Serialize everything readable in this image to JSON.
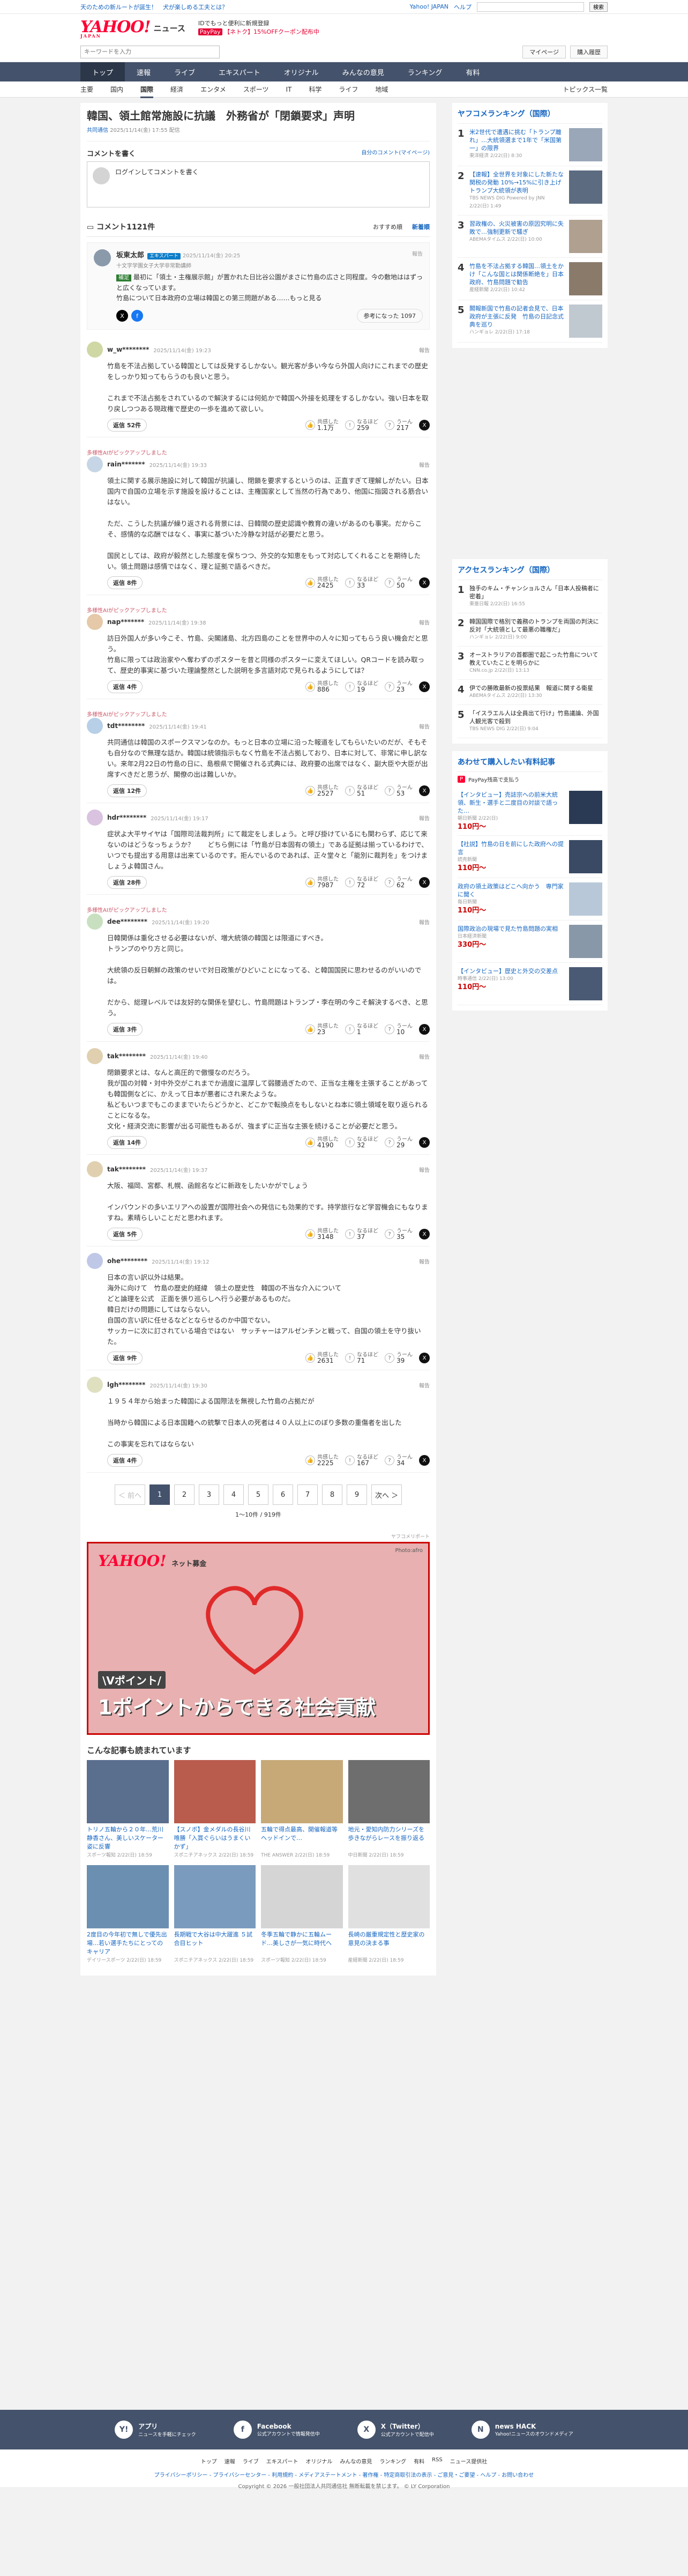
{
  "topbar": {
    "promo": "天のための新ルートが誕生！　犬が楽しめる工夫とは？",
    "links": [
      "Yahoo! JAPAN",
      "ヘルプ"
    ],
    "search_placeholder": "",
    "search_button": "検索"
  },
  "header": {
    "logo": "YAHOO!",
    "logo_sub": "JAPAN",
    "section": "ニュース",
    "promo1": "IDでもっと便利に新規登録",
    "promo2_badge": "PayPay",
    "promo2": "【ネトク】15%OFFクーポン配布中"
  },
  "search": {
    "placeholder": "キーワードを入力",
    "mypage": "マイページ",
    "settings": "購入履歴"
  },
  "gnav": [
    "トップ",
    "速報",
    "ライブ",
    "エキスパート",
    "オリジナル",
    "みんなの意見",
    "ランキング",
    "有料"
  ],
  "subnav": [
    "主要",
    "国内",
    "国際",
    "経済",
    "エンタメ",
    "スポーツ",
    "IT",
    "科学",
    "ライフ",
    "地域"
  ],
  "subnav_right": "トピックス一覧",
  "article": {
    "title": "韓国、領土館常施設に抗議　外務省が「閉鎖要求」声明",
    "source": "共同通信",
    "date": "2025/11/14(金) 17:55 配信"
  },
  "comment_write": {
    "title": "コメントを書く",
    "link": "自分のコメント(マイページ)",
    "placeholder": "ログインしてコメントを書く"
  },
  "comments_header": {
    "label": "コメント1121件",
    "sort1": "おすすめ順",
    "sort2": "新着順"
  },
  "expert": {
    "name": "坂東太郎",
    "badge": "エキスパート",
    "meta": "2025/11/14(金) 20:25",
    "role": "十文字学園女子大学非常勤講師",
    "tag": "補足",
    "body": "最初に「領土・主権展示館」が置かれた日比谷公園がまさに竹島の広さと同程度。今の敷地ははずっと広くなっています。\n竹島について日本政府の立場は韓国との第三問題がある……もっと見る",
    "helpful": "参考になった 1097",
    "report": "報告"
  },
  "comments": [
    {
      "user": "w_w********",
      "time": "2025/11/14(金) 19:23",
      "body": "竹島を不法占拠している韓国としては反発するしかない。観光客が多い今なら外国人向けにこれまでの歴史をしっかり知ってもらうのも良いと思う。\n\nこれまで不法占拠をされているので解決するには何処かで韓国へ外接を処理をするしかない。強い日本を取り戻しつつある現政権で歴史の一歩を進めて欲しい。",
      "replies": "返信 52件",
      "v1": "1.1万",
      "v2": "259",
      "v3": "217",
      "color": "#cfd8a4",
      "pin": ""
    },
    {
      "user": "rain*******",
      "time": "2025/11/14(金) 19:33",
      "body": "領土に関する展示施設に対して韓国が抗議し、閉鎖を要求するというのは、正直すぎて理解しがたい。日本国内で自国の立場を示す施設を設けることは、主権国家として当然の行為であり、他国に指図される筋合いはない。\n\nただ、こうした抗議が繰り返される背景には、日韓間の歴史認識や教育の違いがあるのも事実。だからこそ、感情的な応酬ではなく、事実に基づいた冷静な対話が必要だと思う。\n\n国民としては、政府が毅然とした態度を保ちつつ、外交的な知恵をもって対応してくれることを期待したい。領土問題は感情ではなく、理と証拠で語るべきだ。",
      "replies": "返信 8件",
      "v1": "2425",
      "v2": "33",
      "v3": "50",
      "color": "#c6d6e6",
      "pin": "多様性AIがピックアップしました"
    },
    {
      "user": "nap*******",
      "time": "2025/11/14(金) 19:38",
      "body": "訪日外国人が多い今こそ、竹島、尖閣諸島、北方四島のことを世界中の人々に知ってもらう良い機会だと思う。\n竹島に限っては政治家やへ奪わずのポスターを昔と同様のポスターに変えてほしい。QRコードを読み取って、歴史的事実に基づいた理論整然とした説明を多言語対応で見られるようにしては？",
      "replies": "返信 4件",
      "v1": "886",
      "v2": "19",
      "v3": "23",
      "color": "#e5c9a8",
      "pin": "多様性AIがピックアップしました"
    },
    {
      "user": "tdt********",
      "time": "2025/11/14(金) 19:41",
      "body": "共同通信は韓国のスポークスマンなのか。もっと日本の立場に沿った報道をしてもらいたいのだが、そもそも自分なので無理な話か。韓国は統領指示もなく竹島を不法占拠しており、日本に対して、非常に申し訳ない。来年2月22日の竹島の日に、島根県で開催される式典には、政府要の出席ではなく、副大臣や大臣が出席すべきだと思うが、閣僚の出は難しいか。",
      "replies": "返信 12件",
      "v1": "2527",
      "v2": "51",
      "v3": "53",
      "color": "#b8cfe8",
      "pin": "多様性AIがピックアップしました"
    },
    {
      "user": "hdr********",
      "time": "2025/11/14(金) 19:17",
      "body": "症状よ大平サイヤは「国際司法裁判所」にて裁定をしましょう。と呼び掛けているにも関わらず、応じて来ないのはどうなっちょうか？　　どちら側には「竹島が日本固有の領土」である証拠は揃っているわけで、いつでも提出する用意は出来ているのです。拒んでいるのであれば、正々堂々と「能別に裁判を」をつけましょうよ韓国さん。",
      "replies": "返信 28件",
      "v1": "7987",
      "v2": "72",
      "v3": "62",
      "color": "#d9c3e0",
      "pin": ""
    },
    {
      "user": "dee********",
      "time": "2025/11/14(金) 19:20",
      "body": "日韓関係は重化させる必要はないが、増大統領の韓国とは限道にすべき。\nトランプのやり方と同じ。\n\n大統領の反日朝鮮の政策のせいで対日政策がひどいことになってる、と韓国国民に思わせるのがいいのでは。\n\nだから、総理レベルでは友好的な関係を望むし、竹島問題はトランプ・李在明の今こそ解決するべき、と思う。",
      "replies": "返信 3件",
      "v1": "23",
      "v2": "1",
      "v3": "10",
      "color": "#c8e0c0",
      "pin": "多様性AIがピックアップしました"
    },
    {
      "user": "tak********",
      "time": "2025/11/14(金) 19:40",
      "body": "閉鎖要求とは、なんと高圧的で傲慢なのだろう。\n我が国の対韓・対中外交がこれまでか過度に温厚して弱腰過ぎたので、正当な主権を主張することがあっても韓国側などに、かえって日本が悪者にされ来たような。\n私どもいつまでもこのままでいたらどうかと、どこかで転換点をもしないとね本に領土領域を取り返られることになるな。\n文化・経済交流に影響が出る可能性もあるが、強まずに正当な主張を続けることが必要だと思う。",
      "replies": "返信 14件",
      "v1": "4190",
      "v2": "32",
      "v3": "29",
      "color": "#e0d0b0",
      "pin": ""
    },
    {
      "user": "tak********",
      "time": "2025/11/14(金) 19:37",
      "body": "大阪、福岡、宮都、札幌、函館名などに新政をしたいかがでしょう\n\nインバウンドの多いエリアへの設置が国際社会への発信にも効果的です。持学旅行など学習機会にもなりますね。素晴らしいことだと思われます。",
      "replies": "返信 5件",
      "v1": "3148",
      "v2": "37",
      "v3": "35",
      "color": "#e0d0b0",
      "pin": ""
    },
    {
      "user": "ohe********",
      "time": "2025/11/14(金) 19:12",
      "body": "日本の言い訳以外は結果。\n海外に向けて　竹島の歴史的経緯　領土の歴史性　韓国の不当な介入について\nどと論理を公式　正面を張り巡らしへ行う必要があるものだ。\n韓日だけの問題にしてはならない。\n自国の言い訳に任せるなどとならせるのか中国でない。\nサッカーに次に訂されている場合ではない　サッチャーはアルゼンチンと戦って、自国の領土を守り抜いた。",
      "replies": "返信 9件",
      "v1": "2631",
      "v2": "71",
      "v3": "39",
      "color": "#c0c8e8",
      "pin": ""
    },
    {
      "user": "lgh********",
      "time": "2025/11/14(金) 19:30",
      "body": "１９５４年から始まった韓国による国際法を無視した竹島の占拠だが\n\n当時から韓国による日本国籍への銃撃で日本人の死者は４０人以上にのぼり多数の重傷者を出した\n\nこの事実を忘れてはならない",
      "replies": "返信 4件",
      "v1": "2225",
      "v2": "167",
      "v3": "34",
      "color": "#dfe0c0",
      "pin": ""
    }
  ],
  "labels": {
    "report": "報告",
    "helpful": "共感した",
    "think": "なるほど",
    "hmm": "うーん"
  },
  "pager": {
    "prev": "＜ 前へ",
    "pages": [
      "1",
      "2",
      "3",
      "4",
      "5",
      "6",
      "7",
      "8",
      "9"
    ],
    "next": "次へ ＞",
    "info": "1〜10件 / 919件"
  },
  "ad": {
    "label": "ヤフコメリポート",
    "logo": "YAHOO!",
    "logo_sub": "ネット募金",
    "credit": "Photo:afro",
    "line1": "\\Vポイント/",
    "line2": "1ポイントからできる社会貢献"
  },
  "related": {
    "title": "こんな記事も読まれています",
    "items": [
      {
        "title": "トリノ五輪から２０年…荒川静香さん、美しいスケーター姿に反響",
        "meta": "スポーツ報知",
        "date": "2/22(日) 18:59",
        "color": "#5a6e8e"
      },
      {
        "title": "【スノボ】金メダルの長谷川唯勝「入賞ぐらいはうまくいかず」",
        "meta": "スポニチアネックス",
        "date": "2/22(日) 18:59",
        "color": "#b95b4d"
      },
      {
        "title": "五輪で得点最高、開催報道等ヘッドインで…",
        "meta": "THE ANSWER",
        "date": "2/22(日) 18:59",
        "color": "#c7a978"
      },
      {
        "title": "地元・愛知内防力シリーズを歩きながらレースを振り返る",
        "meta": "中日新聞",
        "date": "2/22(日) 18:59",
        "color": "#6e6e6e"
      },
      {
        "title": "2度目の今年初で無しで優先出場…若い選手たちにとってのキャリア",
        "meta": "デイリースポーツ",
        "date": "2/22(日) 18:59",
        "color": "#6b8fb0"
      },
      {
        "title": "長期戦で大谷は中大躍進 ５試合目ヒット",
        "meta": "スポニチアネックス",
        "date": "2/22(日) 18:59",
        "color": "#7a9bbd"
      },
      {
        "title": "冬季五輪で静かに五輪ムード…美しさが一気に時代へ",
        "meta": "スポーツ報知",
        "date": "2/22(日) 18:59",
        "color": "#d5d5d5"
      },
      {
        "title": "長崎の厳重規定性と歴史家の意見の決まる事",
        "meta": "産経新聞",
        "date": "2/22(日) 18:59",
        "color": "#e0e0e0"
      }
    ]
  },
  "side": {
    "expert_ranking": {
      "title": "ヤフコメランキング（国際）",
      "items": [
        {
          "text": "米2世代で遭遇に挑む「トランプ離れ」…大統領選まで1年で「米国第一」の限界",
          "meta": "東洋経済 2/22(日) 8:30"
        },
        {
          "text": "【速報】全世界を対象にした新たな関税の発動 10%→15%に引き上げ　トランプ大統領が表明",
          "meta": "TBS NEWS DIG Powered by JNN 2/22(日) 1:49"
        },
        {
          "text": "習政権の、火災被害の原因究明に失敗で…強制更新で騒ぎ",
          "meta": "ABEMAタイムス 2/22(日) 10:00"
        },
        {
          "text": "竹島を不法占拠する韓国…領土をかけ「こんな国とは関係断絶を」日本政府、竹島問題で勧告",
          "meta": "産経新聞 2/22(日) 10:42"
        },
        {
          "text": "閣報新国で竹島の記者会見で、日本政府が主張に反発　竹島の日記念式典を巡り",
          "meta": "ハンギョレ 2/22(日) 17:18"
        }
      ]
    },
    "access_ranking": {
      "title": "アクセスランキング（国際）",
      "items": [
        {
          "text": "独手のキム・チャンショルさん「日本人投稿者に密着」",
          "meta": "東亜日報 2/22(日) 16:55"
        },
        {
          "text": "韓国国際で格別で義務のトランプを両国の判決に反対「大統領として最悪の職権だ」",
          "meta": "ハンギョレ 2/22(日) 9:00"
        },
        {
          "text": "オーストラリアの首都圏で起こった竹島について教えていたことを明らかに",
          "meta": "CNN.co.jp 2/22(日) 13:13"
        },
        {
          "text": "伊での勝敗最新の投票結果　報道に関する衛星",
          "meta": "ABEMAタイムス 2/22(日) 13:30"
        },
        {
          "text": "「イスラエル人は全員出て行け」竹島議論、外国人観光客で殺到",
          "meta": "TBS NEWS DIG 2/22(日) 9:04"
        }
      ]
    },
    "shop": {
      "title": "あわせて購入したい有料記事",
      "sub": "PayPay残高で支払う",
      "items": [
        {
          "text": "【インタビュー】売誌宗への前米大統領、新生・選手と二度目の対談で語った…",
          "meta": "朝日新聞 2/22(日)",
          "price": "110円〜",
          "color": "#2a3a55"
        },
        {
          "text": "【社説】竹島の日を前にした政府への提言",
          "meta": "読売新聞",
          "price": "110円〜",
          "color": "#3a4a65"
        },
        {
          "text": "政府の領土政策はどこへ向かう　専門家に聞く",
          "meta": "毎日新聞",
          "price": "110円〜",
          "color": "#b8c8d8"
        },
        {
          "text": "国際政治の現場で見た竹島問題の実相",
          "meta": "日本経済新聞",
          "price": "330円〜",
          "color": "#8898a8"
        },
        {
          "text": "【インタビュー】歴史と外交の交差点",
          "meta": "時事通信 2/22(日) 13:00",
          "price": "110円〜",
          "color": "#4a5a75"
        }
      ]
    }
  },
  "footer": {
    "apps": [
      {
        "name": "アプリ",
        "desc": "ニュースを手軽にチェック",
        "icon": "Y!"
      },
      {
        "name": "Facebook",
        "desc": "公式アカウントで情報発信中",
        "icon": "f"
      },
      {
        "name": "X（Twitter）",
        "desc": "公式アカウントで配信中",
        "icon": "X"
      },
      {
        "name": "news HACK",
        "desc": "Yahoo!ニュースのオウンドメディア",
        "icon": "N"
      }
    ],
    "nav": [
      "トップ",
      "速報",
      "ライブ",
      "エキスパート",
      "オリジナル",
      "みんなの意見",
      "ランキング",
      "有料",
      "RSS",
      "ニュース提供社"
    ],
    "links": "プライバシーポリシー - プライバシーセンター - 利用規約 - メディアステートメント - 著作権 - 特定商取引法の表示 - ご意見・ご要望 - ヘルプ - お問い合わせ",
    "copyright": "Copyright © 2026 一般社団法人共同通信社 無断転載を禁じます。 © LY Corporation"
  }
}
